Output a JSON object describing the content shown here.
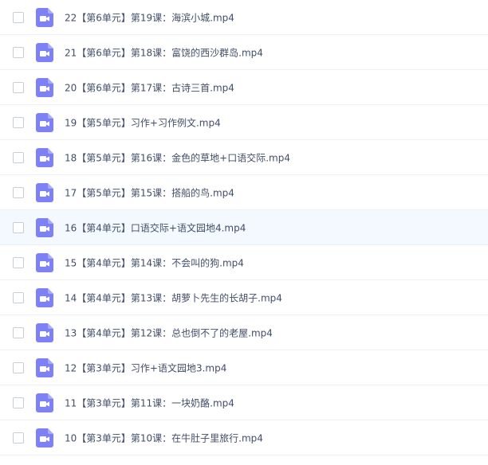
{
  "file_list": {
    "icon": "video-file-icon",
    "icon_color": "#7e80f5",
    "hover_row_index": 6,
    "items": [
      {
        "name": "22【第6单元】第19课：海滨小城.mp4"
      },
      {
        "name": "21【第6单元】第18课：富饶的西沙群岛.mp4"
      },
      {
        "name": "20【第6单元】第17课：古诗三首.mp4"
      },
      {
        "name": "19【第5单元】习作+习作例文.mp4"
      },
      {
        "name": "18【第5单元】第16课：金色的草地+口语交际.mp4"
      },
      {
        "name": "17【第5单元】第15课：搭船的鸟.mp4"
      },
      {
        "name": "16【第4单元】口语交际+语文园地4.mp4"
      },
      {
        "name": "15【第4单元】第14课：不会叫的狗.mp4"
      },
      {
        "name": "14【第4单元】第13课：胡萝卜先生的长胡子.mp4"
      },
      {
        "name": "13【第4单元】第12课：总也倒不了的老屋.mp4"
      },
      {
        "name": "12【第3单元】习作+语文园地3.mp4"
      },
      {
        "name": "11【第3单元】第11课：一块奶酪.mp4"
      },
      {
        "name": "10【第3单元】第10课：在牛肚子里旅行.mp4"
      }
    ]
  }
}
